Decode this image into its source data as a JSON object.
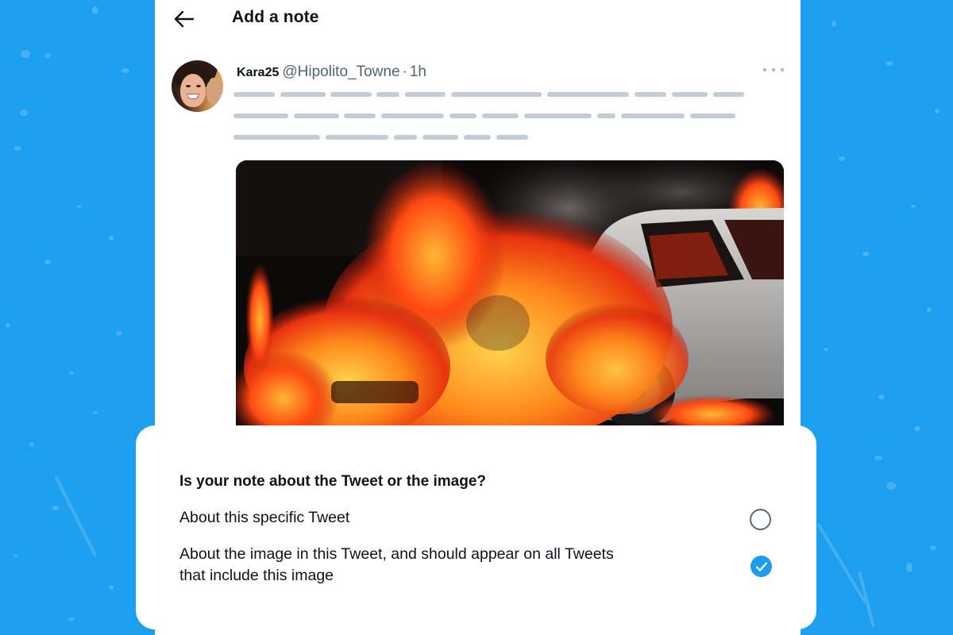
{
  "page": {
    "title": "Add a note",
    "background_color": "#1c9fee",
    "accent_color": "#1d9bf0"
  },
  "tweet": {
    "display_name": "Kara25",
    "handle": "@Hipolito_Towne",
    "separator": "·",
    "time": "1h",
    "more_icon": "more-horizontal-icon",
    "media_description": "Burning car engulfed in flames"
  },
  "sheet": {
    "question": "Is your note about the Tweet or the image?",
    "options": [
      {
        "label": "About this specific Tweet",
        "selected": false
      },
      {
        "label": "About the image in this Tweet, and should appear on all Tweets that include this image",
        "selected": true
      }
    ]
  },
  "icons": {
    "back": "arrow-left-icon",
    "radio_unchecked": "radio-unchecked-icon",
    "radio_checked": "checkmark-circle-icon"
  }
}
